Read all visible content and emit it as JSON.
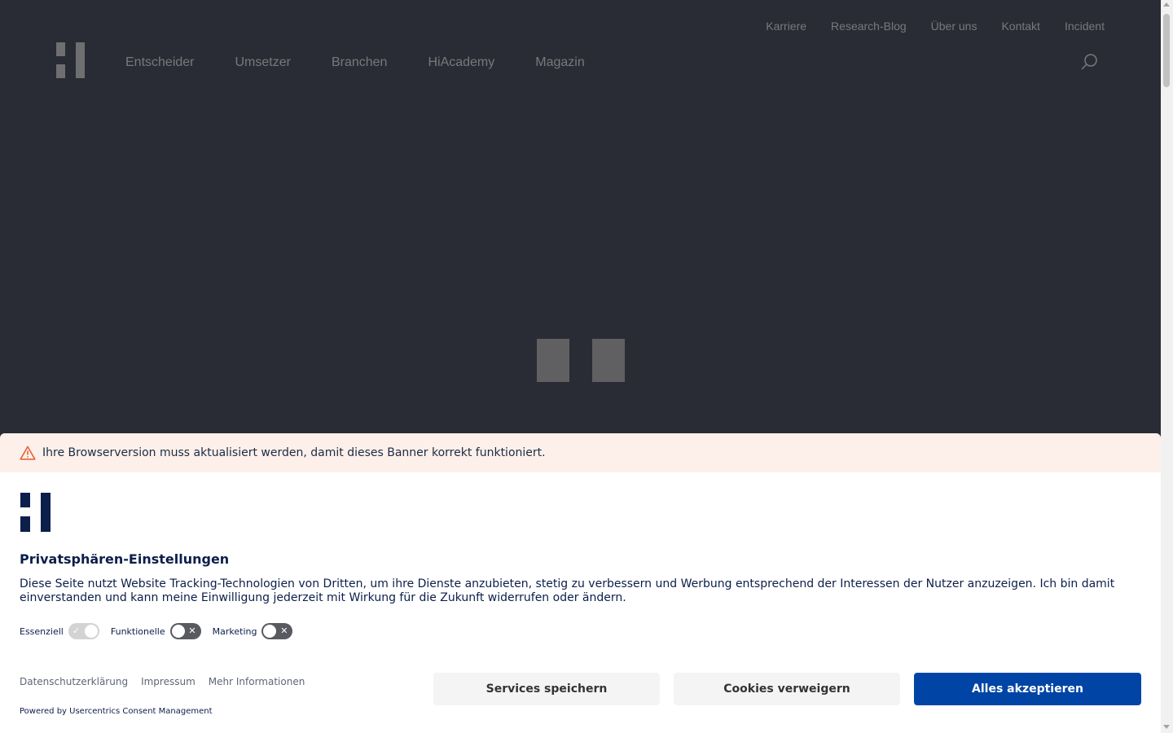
{
  "header": {
    "top_links": [
      "Karriere",
      "Research-Blog",
      "Über uns",
      "Kontakt",
      "Incident"
    ],
    "main_nav": [
      "Entscheider",
      "Umsetzer",
      "Branchen",
      "HiAcademy",
      "Magazin"
    ]
  },
  "consent": {
    "warning": "Ihre Browserversion muss aktualisiert werden, damit dieses Banner korrekt funktioniert.",
    "title": "Privatsphären-Einstellungen",
    "description": "Diese Seite nutzt Website Tracking-Technologien von Dritten, um ihre Dienste anzubieten, stetig zu verbessern und Werbung entsprechend der Interessen der Nutzer anzuzeigen. Ich bin damit einverstanden und kann meine Einwilligung jederzeit mit Wirkung für die Zukunft widerrufen oder ändern.",
    "toggles": [
      {
        "label": "Essenziell",
        "state": "on"
      },
      {
        "label": "Funktionelle",
        "state": "off"
      },
      {
        "label": "Marketing",
        "state": "off"
      }
    ],
    "links": [
      "Datenschutzerklärung",
      "Impressum",
      "Mehr Informationen"
    ],
    "powered_by": "Powered by Usercentrics Consent Management",
    "buttons": {
      "save": "Services speichern",
      "deny": "Cookies verweigern",
      "accept": "Alles akzeptieren"
    }
  },
  "colors": {
    "page_background": "#292c34",
    "accent_button": "#0045a5",
    "brand_navy": "#0b1f4a",
    "warning_background": "#fdf0ea",
    "warning_icon": "#e2643a"
  },
  "icons": {
    "search": "search-icon",
    "warning": "warning-icon"
  }
}
